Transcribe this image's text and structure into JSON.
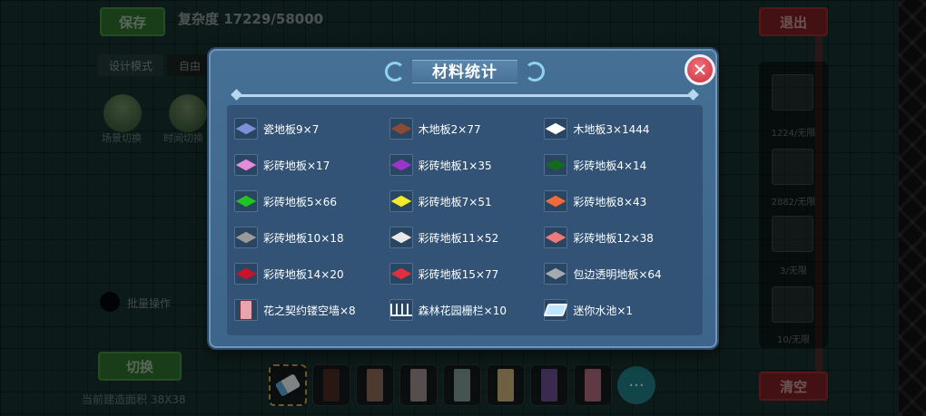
{
  "hud": {
    "save_label": "保存",
    "exit_label": "退出",
    "clear_label": "清空",
    "switch_label": "切换",
    "complexity_text": "复杂度 17229/58000",
    "design_mode": "设计模式",
    "free_mode": "自由",
    "scene_switch_1": "场景切换",
    "scene_switch_2": "时间切换",
    "batch_label": "批量操作",
    "size_label": "当前建造面积 38X38",
    "right_counts": [
      "1224/无限",
      "2882/无限",
      "3/无限",
      "10/无限"
    ]
  },
  "modal": {
    "title": "材料统计",
    "close_icon": "close-icon"
  },
  "materials": [
    {
      "label": "瓷地板9×7",
      "color": "#7d8fd8",
      "icon": "diamond"
    },
    {
      "label": "木地板2×77",
      "color": "#8a4a35",
      "icon": "diamond"
    },
    {
      "label": "木地板3×1444",
      "color": "#ffffff",
      "icon": "diamond"
    },
    {
      "label": "彩砖地板×17",
      "color": "#e58bd9",
      "icon": "diamond"
    },
    {
      "label": "彩砖地板1×35",
      "color": "#9b35c9",
      "icon": "diamond"
    },
    {
      "label": "彩砖地板4×14",
      "color": "#136b1f",
      "icon": "diamond"
    },
    {
      "label": "彩砖地板5×66",
      "color": "#22c322",
      "icon": "diamond"
    },
    {
      "label": "彩砖地板7×51",
      "color": "#f2ea2a",
      "icon": "diamond"
    },
    {
      "label": "彩砖地板8×43",
      "color": "#f06b3c",
      "icon": "diamond"
    },
    {
      "label": "彩砖地板10×18",
      "color": "#9a9a9a",
      "icon": "diamond"
    },
    {
      "label": "彩砖地板11×52",
      "color": "#e8e8e8",
      "icon": "diamond"
    },
    {
      "label": "彩砖地板12×38",
      "color": "#f07a7a",
      "icon": "diamond"
    },
    {
      "label": "彩砖地板14×20",
      "color": "#c8142a",
      "icon": "diamond"
    },
    {
      "label": "彩砖地板15×77",
      "color": "#e0303e",
      "icon": "diamond"
    },
    {
      "label": "包边透明地板×64",
      "color": "#a3aab0",
      "icon": "diamond"
    },
    {
      "label": "花之契约镂空墙×8",
      "color": "#e9a5ae",
      "icon": "wall"
    },
    {
      "label": "森林花园栅栏×10",
      "color": "#e7eef4",
      "icon": "fence"
    },
    {
      "label": "迷你水池×1",
      "color": "#bfe6ff",
      "icon": "pool"
    }
  ],
  "hotbar": {
    "slots": [
      {
        "name": "eraser-slot",
        "color": "#5ca6d8"
      },
      {
        "name": "door-slot",
        "color": "#4a2a22"
      },
      {
        "name": "door-slot",
        "color": "#8a6a5a"
      },
      {
        "name": "door-slot",
        "color": "#9a8f8a"
      },
      {
        "name": "door-slot",
        "color": "#7e9a92"
      },
      {
        "name": "door-slot",
        "color": "#c9b07a"
      },
      {
        "name": "door-slot",
        "color": "#6a4f8f"
      },
      {
        "name": "door-slot",
        "color": "#b06a78"
      }
    ],
    "more_label": "···"
  }
}
